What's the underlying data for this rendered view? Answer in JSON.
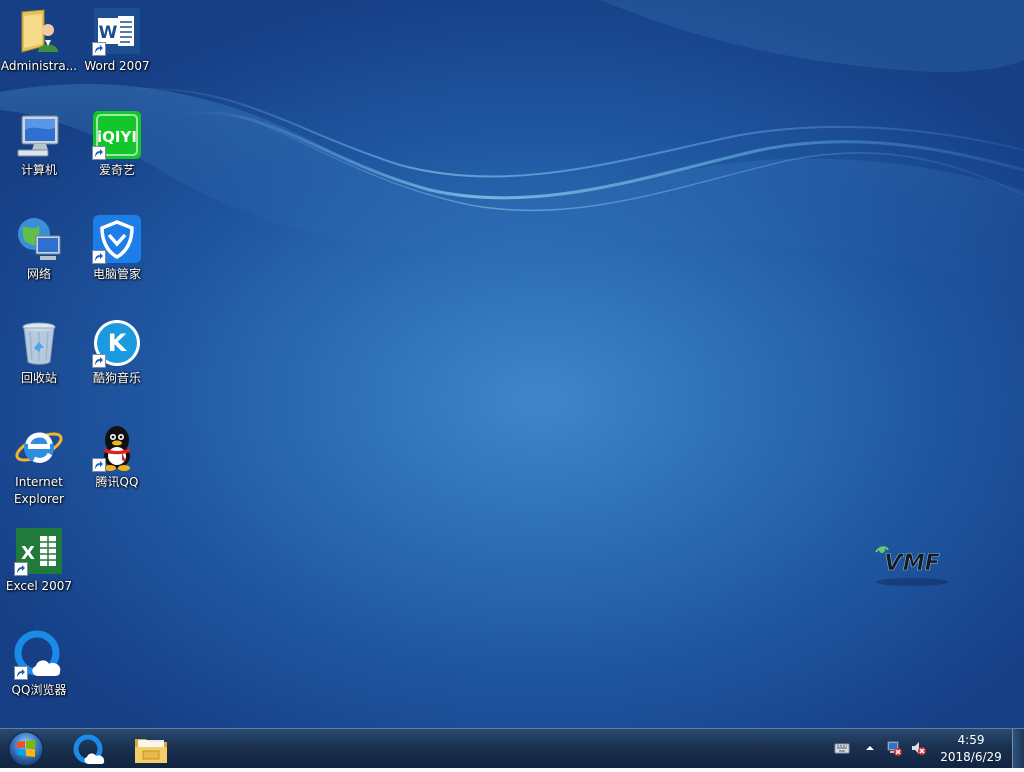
{
  "desktop": {
    "icons": [
      {
        "id": "administrator",
        "label": "Administra...",
        "icon": "user-folder-icon",
        "shortcut": false
      },
      {
        "id": "computer",
        "label": "计算机",
        "icon": "computer-icon",
        "shortcut": false
      },
      {
        "id": "network",
        "label": "网络",
        "icon": "network-icon",
        "shortcut": false
      },
      {
        "id": "recycle-bin",
        "label": "回收站",
        "icon": "recycle-bin-icon",
        "shortcut": false
      },
      {
        "id": "internet-explorer",
        "label": "Internet Explorer",
        "icon": "internet-explorer-icon",
        "shortcut": false
      },
      {
        "id": "excel-2007",
        "label": "Excel 2007",
        "icon": "excel-icon",
        "shortcut": true
      },
      {
        "id": "qq-browser",
        "label": "QQ浏览器",
        "icon": "qq-browser-icon",
        "shortcut": true
      },
      {
        "id": "word-2007",
        "label": "Word 2007",
        "icon": "word-icon",
        "shortcut": true
      },
      {
        "id": "iqiyi",
        "label": "爱奇艺",
        "icon": "iqiyi-icon",
        "shortcut": true
      },
      {
        "id": "pc-manager",
        "label": "电脑管家",
        "icon": "pc-manager-icon",
        "shortcut": true
      },
      {
        "id": "kugou-music",
        "label": "酷狗音乐",
        "icon": "kugou-icon",
        "shortcut": true
      },
      {
        "id": "tencent-qq",
        "label": "腾讯QQ",
        "icon": "qq-penguin-icon",
        "shortcut": true
      }
    ],
    "iqiyi_logo_text": "iQIYI",
    "word_logo_letter": "W",
    "excel_logo_letter": "X",
    "kugou_logo_letter": "K",
    "brand_logo_text": "ѴMF"
  },
  "taskbar": {
    "start_icon": "windows-orb-icon",
    "pinned": [
      {
        "id": "qq-browser",
        "icon": "qq-browser-icon"
      },
      {
        "id": "file-explorer",
        "icon": "file-explorer-icon"
      }
    ],
    "tray": {
      "icons": [
        "keyboard-icon",
        "show-hidden-icons-icon",
        "network-disconnected-icon",
        "volume-muted-icon"
      ]
    },
    "clock": {
      "time": "4:59",
      "date": "2018/6/29"
    }
  },
  "colors": {
    "taskbar": "#1a3150",
    "desktop_center": "#3f86c9",
    "desktop_edge": "#163f86",
    "label_text": "#ffffff"
  }
}
